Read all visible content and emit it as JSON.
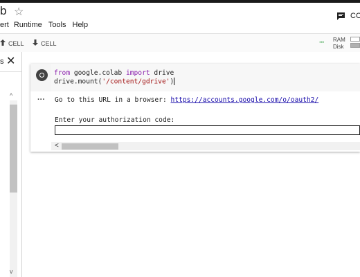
{
  "app": {
    "title": "b",
    "comment_label": "CO"
  },
  "menu": {
    "items": [
      "ert",
      "Runtime",
      "Tools",
      "Help"
    ]
  },
  "toolbar": {
    "cell_up_label": "CELL",
    "cell_down_label": "CELL",
    "ram_label": "RAM",
    "disk_label": "Disk"
  },
  "sidebar": {
    "heading": "s"
  },
  "cell": {
    "code_line1_kw1": "from",
    "code_line1_mid": " google.colab ",
    "code_line1_kw2": "import",
    "code_line1_end": " drive",
    "code_line2_pre": "drive.mount(",
    "code_line2_str": "'/content/gdrive'",
    "code_line2_end": ")",
    "output_prefix": "Go to this URL in a browser: ",
    "output_link": "https://accounts.google.com/o/oauth2/",
    "auth_label": "Enter your authorization code:",
    "auth_value": ""
  },
  "colors": {
    "accent": "#1a0dab",
    "keyword": "#8b20ad",
    "string": "#a31515",
    "connected": "#2e9c3e"
  }
}
